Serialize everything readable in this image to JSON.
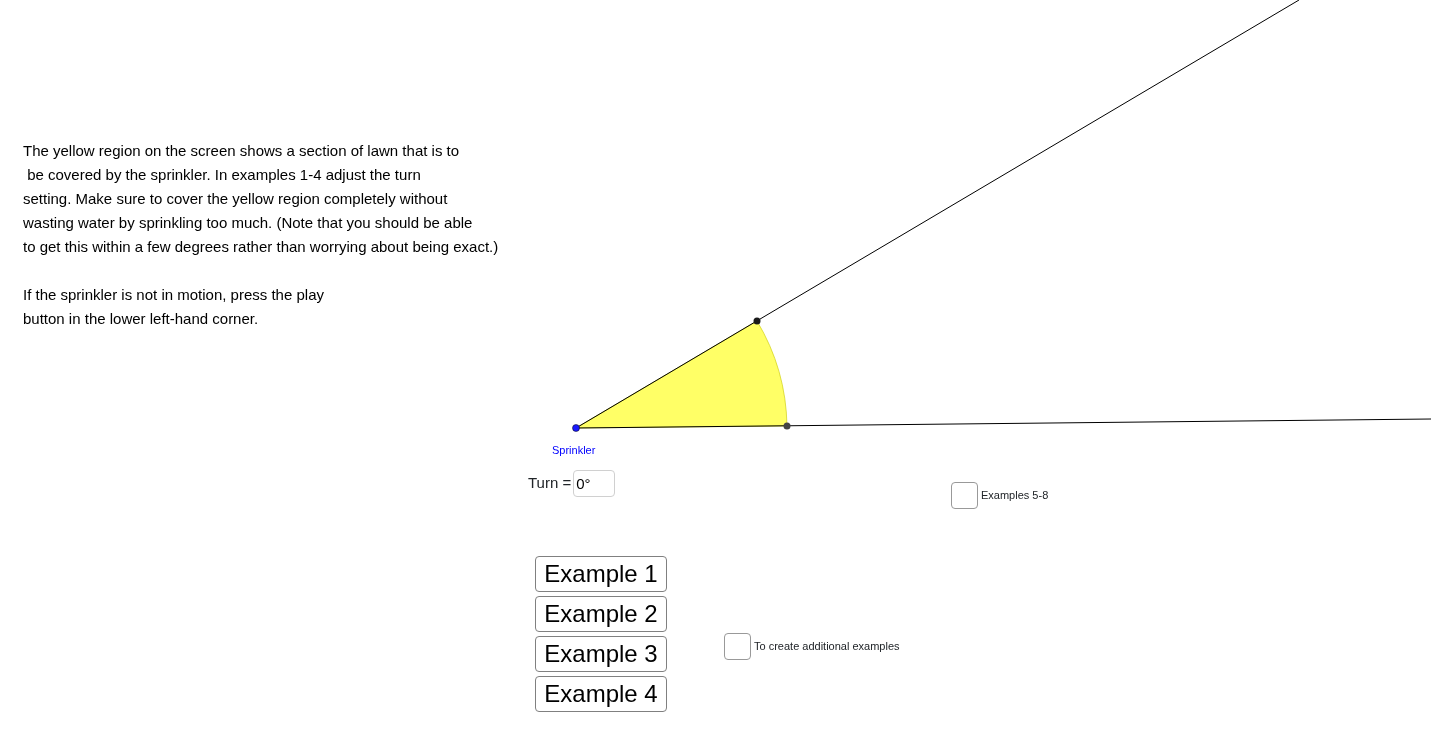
{
  "instructions": {
    "paragraphs": [
      [
        "The yellow region on the screen shows a section of lawn that is to",
        " be covered by the sprinkler. In examples 1-4 adjust the turn",
        "setting. Make sure to cover the yellow region completely without",
        "wasting water by sprinkling too much. (Note that you should be able",
        "to get this within a few degrees rather than worrying about being exact.)"
      ],
      [
        "If the sprinkler is not in motion, press the play",
        "button in the lower left-hand corner."
      ]
    ]
  },
  "sprinkler_label": "Sprinkler",
  "turn": {
    "label": "Turn =",
    "value": "0°"
  },
  "checkboxes": [
    {
      "label": "Examples 5-8",
      "checked": false
    },
    {
      "label": "To create additional examples",
      "checked": false
    }
  ],
  "buttons": [
    "Example 1",
    "Example 2",
    "Example 3",
    "Example 4"
  ]
}
